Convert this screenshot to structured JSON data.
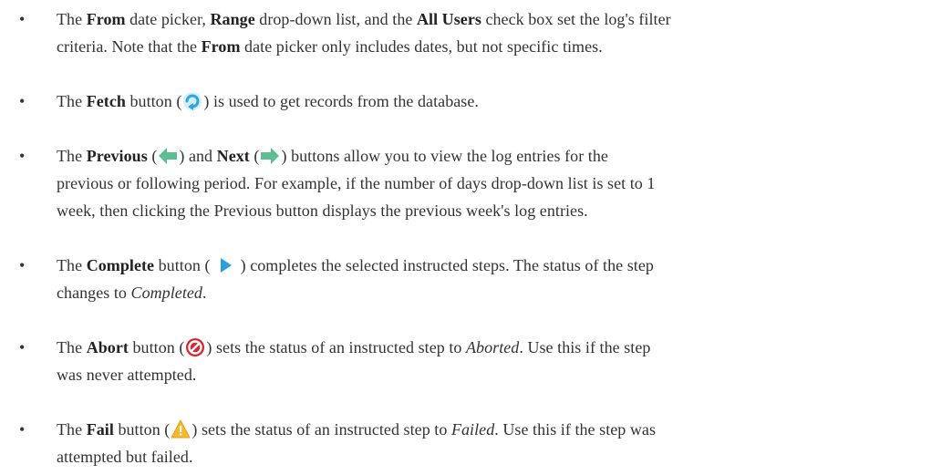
{
  "bullet_char": "•",
  "items": [
    {
      "p1": "The ",
      "b1": "From",
      "p2": " date picker, ",
      "b2": "Range",
      "p3": " drop-down list, and the ",
      "b3": "All Users",
      "p4": " check box set the log's filter",
      "line2": "criteria. Note that the ",
      "b4": "From",
      "p5": " date picker only includes dates, but not specific times."
    },
    {
      "p1": "The ",
      "b1": "Fetch",
      "p2": " button (",
      "icon": "refresh-icon",
      "p3": ") is used to get records from the database."
    },
    {
      "p1": "The ",
      "b1": "Previous",
      "p2": " (",
      "icon1": "left-arrow-icon",
      "p3": ") and ",
      "b2": "Next",
      "p4": " (",
      "icon2": "right-arrow-icon",
      "p5": ") buttons allow you to view the log entries for the",
      "line2": "previous or following period. For example, if the number of days drop-down list is set to 1",
      "line3": "week, then clicking the Previous button displays the previous week's log entries."
    },
    {
      "p1": "The ",
      "b1": "Complete",
      "p2": " button ( ",
      "icon": "play-icon",
      "p3": " ) completes the selected instructed steps. The status of the step",
      "line2": "changes to ",
      "i1": "Completed",
      "p4": "."
    },
    {
      "p1": "The ",
      "b1": "Abort",
      "p2": " button (",
      "icon": "abort-icon",
      "p3": ") sets the status of an instructed step to ",
      "i1": "Aborted",
      "p4": ". Use this if the step",
      "line2": "was never attempted."
    },
    {
      "p1": "The ",
      "b1": "Fail",
      "p2": " button (",
      "icon": "warning-icon",
      "p3": ") sets the status of an instructed step to ",
      "i1": "Failed",
      "p4": ". Use this if the step was",
      "line2": "attempted but failed."
    }
  ],
  "colors": {
    "text": "#333333",
    "fetch_icon": "#29a8e0",
    "arrow_icon": "#5cbf8f",
    "play_icon": "#2f9fd6",
    "abort_icon": "#d9262e",
    "warning_icon": "#f5b82e"
  }
}
